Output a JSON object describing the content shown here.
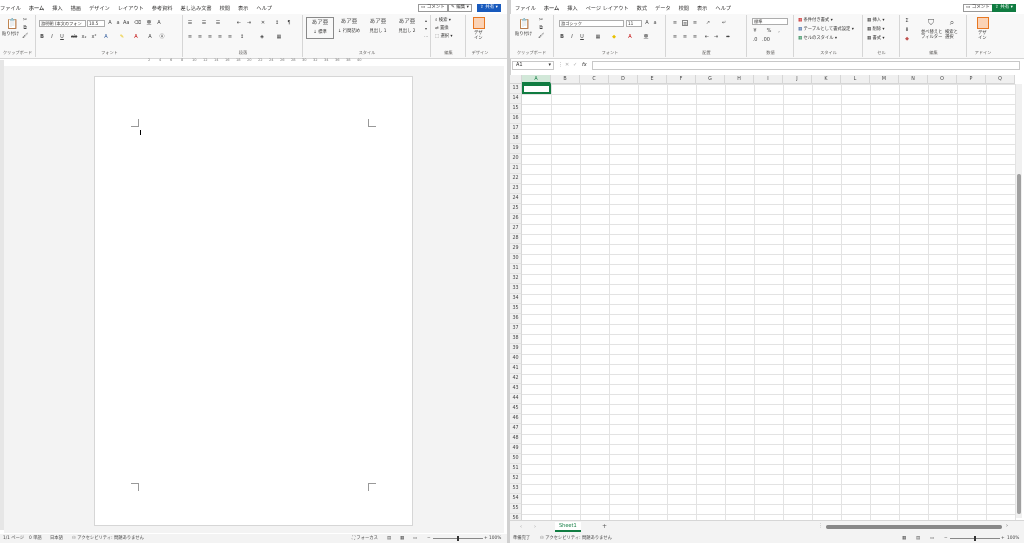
{
  "word": {
    "tabs": [
      "ファイル",
      "ホーム",
      "挿入",
      "描画",
      "デザイン",
      "レイアウト",
      "参考資料",
      "差し込み文書",
      "校閲",
      "表示",
      "ヘルプ"
    ],
    "active_tab": 1,
    "comment_btn": "コメント",
    "edit_btn": "編集",
    "share_btn": "共有",
    "paste_label": "貼り付け",
    "font_name": "游明朝 (本文のフォン",
    "font_size": "10.5",
    "styles": [
      {
        "preview": "あア亜",
        "name": "↓ 標準"
      },
      {
        "preview": "あア亜",
        "name": "↓ 行間詰め"
      },
      {
        "preview": "あア亜",
        "name": "見出し 1"
      },
      {
        "preview": "あア亜",
        "name": "見出し 2"
      }
    ],
    "edit_items": [
      "検索",
      "置換",
      "選択"
    ],
    "design_label": "デザ\nイン",
    "group_labels": {
      "clipboard": "クリップボード",
      "font": "フォント",
      "paragraph": "段落",
      "styles": "スタイル",
      "editing": "編集",
      "designer": "デザイン"
    },
    "ruler_ticks": [
      "2",
      "4",
      "6",
      "8",
      "10",
      "12",
      "14",
      "16",
      "18",
      "20",
      "22",
      "24",
      "26",
      "28",
      "30",
      "32",
      "34",
      "36",
      "38",
      "40"
    ],
    "status": {
      "page": "1/1 ページ",
      "words": "0 単語",
      "lang": "日本語",
      "access": "アクセシビリティ: 問題ありません",
      "focus": "フォーカス",
      "zoom": "100%"
    }
  },
  "excel": {
    "tabs": [
      "ファイル",
      "ホーム",
      "挿入",
      "ページ レイアウト",
      "数式",
      "データ",
      "校閲",
      "表示",
      "ヘルプ"
    ],
    "active_tab": 1,
    "comment_btn": "コメント",
    "share_btn": "共有",
    "paste_label": "貼り付け",
    "font_name": "游ゴシック",
    "font_size": "11",
    "number_format": "標準",
    "style_items": [
      "条件付き書式",
      "テーブルとして書式設定",
      "セルのスタイル"
    ],
    "cell_items": [
      "挿入",
      "削除",
      "書式"
    ],
    "sort_label": "並べ替えと\nフィルター",
    "find_label": "検索と\n選択",
    "design_label": "デザ\nイン",
    "group_labels": {
      "clipboard": "クリップボード",
      "font": "フォント",
      "alignment": "配置",
      "number": "数値",
      "styles": "スタイル",
      "cells": "セル",
      "editing": "編集",
      "designer": "アドイン"
    },
    "name_box": "A1",
    "fx": "fx",
    "columns": [
      "A",
      "B",
      "C",
      "D",
      "E",
      "F",
      "G",
      "H",
      "I",
      "J",
      "K",
      "L",
      "M",
      "N",
      "O",
      "P",
      "Q"
    ],
    "rows": [
      "13",
      "14",
      "15",
      "16",
      "17",
      "18",
      "19",
      "20",
      "21",
      "22",
      "23",
      "24",
      "25",
      "26",
      "27",
      "28",
      "29",
      "30",
      "31",
      "32",
      "33",
      "34",
      "35",
      "36",
      "37",
      "38",
      "39",
      "40",
      "41",
      "42",
      "43",
      "44",
      "45",
      "46",
      "47",
      "48",
      "49",
      "50",
      "51",
      "52",
      "53",
      "54",
      "55",
      "56"
    ],
    "sheet": "Sheet1",
    "status": {
      "ready": "準備完了",
      "access": "アクセシビリティ: 問題ありません",
      "zoom": "100%"
    },
    "colors": {
      "share_bg": "#107c41"
    }
  },
  "colors": {
    "word_share_bg": "#185abd"
  }
}
